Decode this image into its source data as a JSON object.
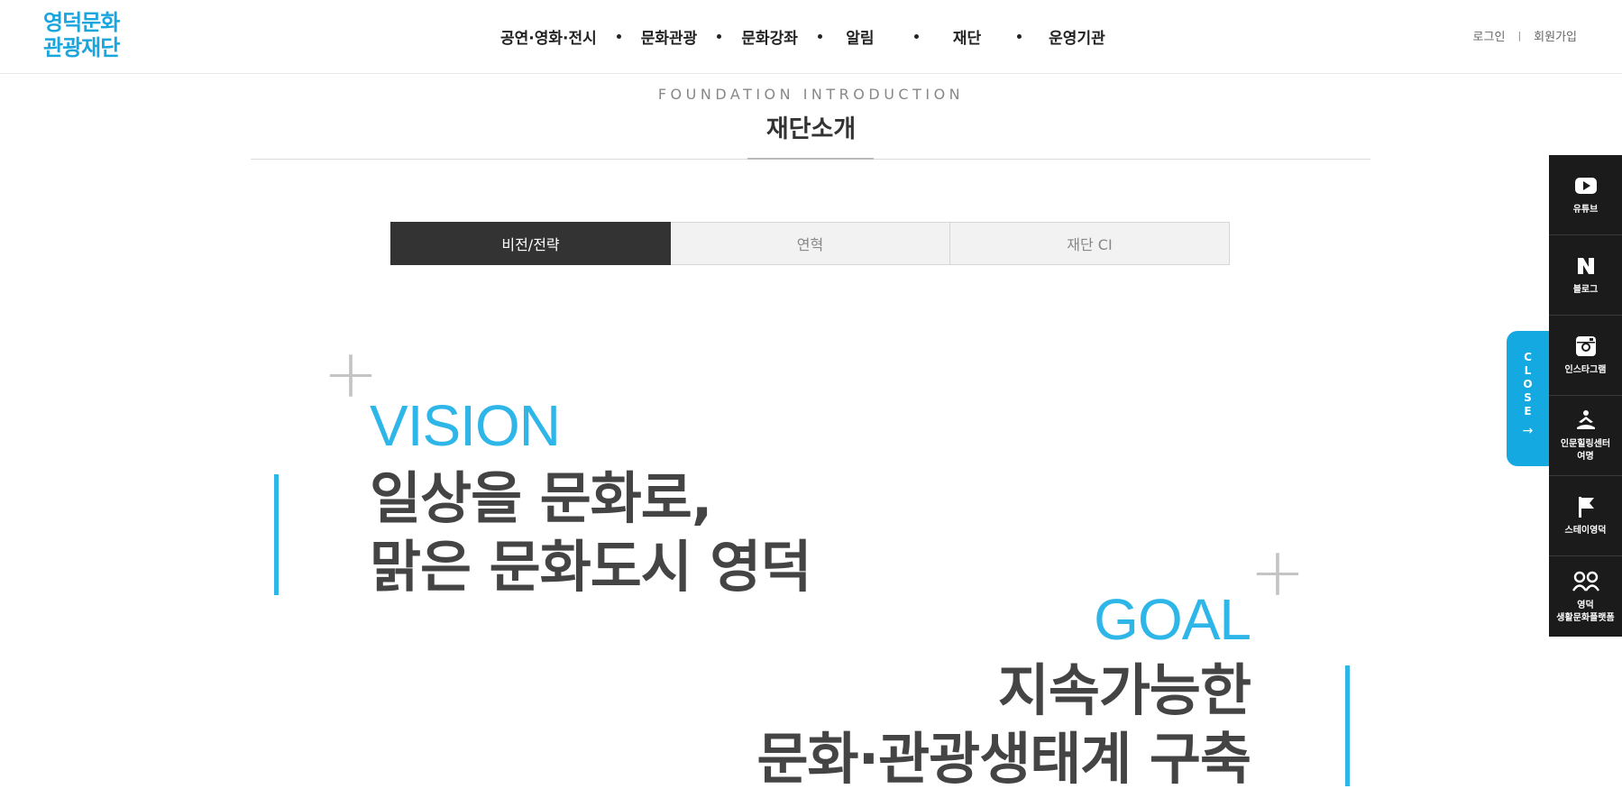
{
  "header": {
    "logo": {
      "line1": "영덕문화",
      "line2": "관광재단"
    },
    "nav": [
      "공연·영화·전시",
      "문화관광",
      "문화강좌",
      "알림",
      "재단",
      "운영기관"
    ],
    "util": {
      "login": "로그인",
      "join": "회원가입"
    }
  },
  "page": {
    "subtitle_en": "FOUNDATION INTRODUCTION",
    "title": "재단소개"
  },
  "tabs": [
    {
      "label": "비전/전략",
      "active": true
    },
    {
      "label": "연혁",
      "active": false
    },
    {
      "label": "재단 CI",
      "active": false
    }
  ],
  "vision": {
    "label": "VISION",
    "line1": "일상을 문화로,",
    "line2": "맑은 문화도시 영덕"
  },
  "goal": {
    "label": "GOAL",
    "line1": "지속가능한",
    "line2": "문화·관광생태계 구축"
  },
  "close_tab": {
    "letters": [
      "C",
      "L",
      "O",
      "S",
      "E"
    ],
    "arrow": "→"
  },
  "quick_menu": [
    {
      "icon": "youtube-icon",
      "label": "유튜브"
    },
    {
      "icon": "naver-blog-icon",
      "label": "블로그"
    },
    {
      "icon": "instagram-icon",
      "label": "인스타그램"
    },
    {
      "icon": "meditation-icon",
      "label": "인문힐링센터\n여명"
    },
    {
      "icon": "flag-icon",
      "label": "스테이영덕"
    },
    {
      "icon": "people-icon",
      "label": "영덕\n생활문화플랫폼"
    }
  ],
  "colors": {
    "accent": "#2fb6e8",
    "close_tab": "#14a9e0",
    "quick_bg": "#1b1b1b",
    "tab_active": "#333333"
  }
}
